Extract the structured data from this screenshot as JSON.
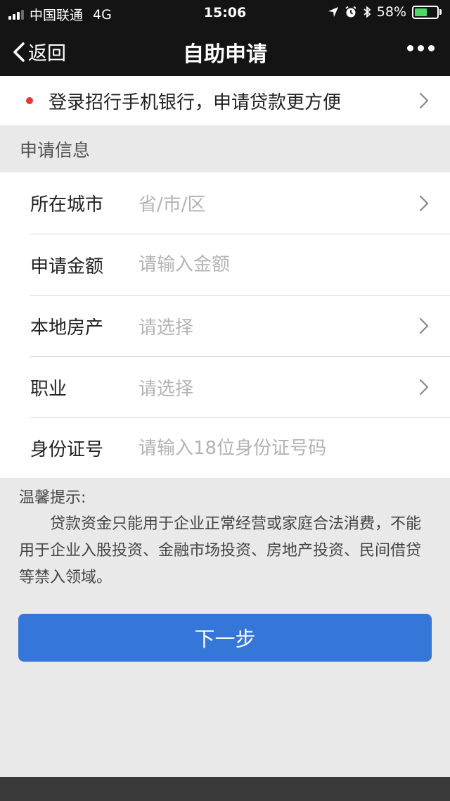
{
  "status_bar": {
    "carrier": "中国联通",
    "network": "4G",
    "time": "15:06",
    "battery": "58%",
    "battery_level": 0.58
  },
  "nav": {
    "back_label": "返回",
    "title": "自助申请"
  },
  "banner": {
    "text": "登录招行手机银行，申请贷款更方便"
  },
  "section": {
    "title": "申请信息"
  },
  "form": {
    "city": {
      "label": "所在城市",
      "placeholder": "省/市/区"
    },
    "amount": {
      "label": "申请金额",
      "placeholder": "请输入金额"
    },
    "property": {
      "label": "本地房产",
      "placeholder": "请选择"
    },
    "occupation": {
      "label": "职业",
      "placeholder": "请选择"
    },
    "id_number": {
      "label": "身份证号",
      "placeholder": "请输入18位身份证号码"
    }
  },
  "tips": {
    "title": "温馨提示:",
    "body": "贷款资金只能用于企业正常经营或家庭合法消费，不能用于企业入股投资、金融市场投资、房地产投资、民间借贷等禁入领域。"
  },
  "actions": {
    "next_label": "下一步"
  },
  "colors": {
    "accent": "#3577d9",
    "dot": "#e53935",
    "battery": "#4cd964",
    "header": "#141414"
  }
}
